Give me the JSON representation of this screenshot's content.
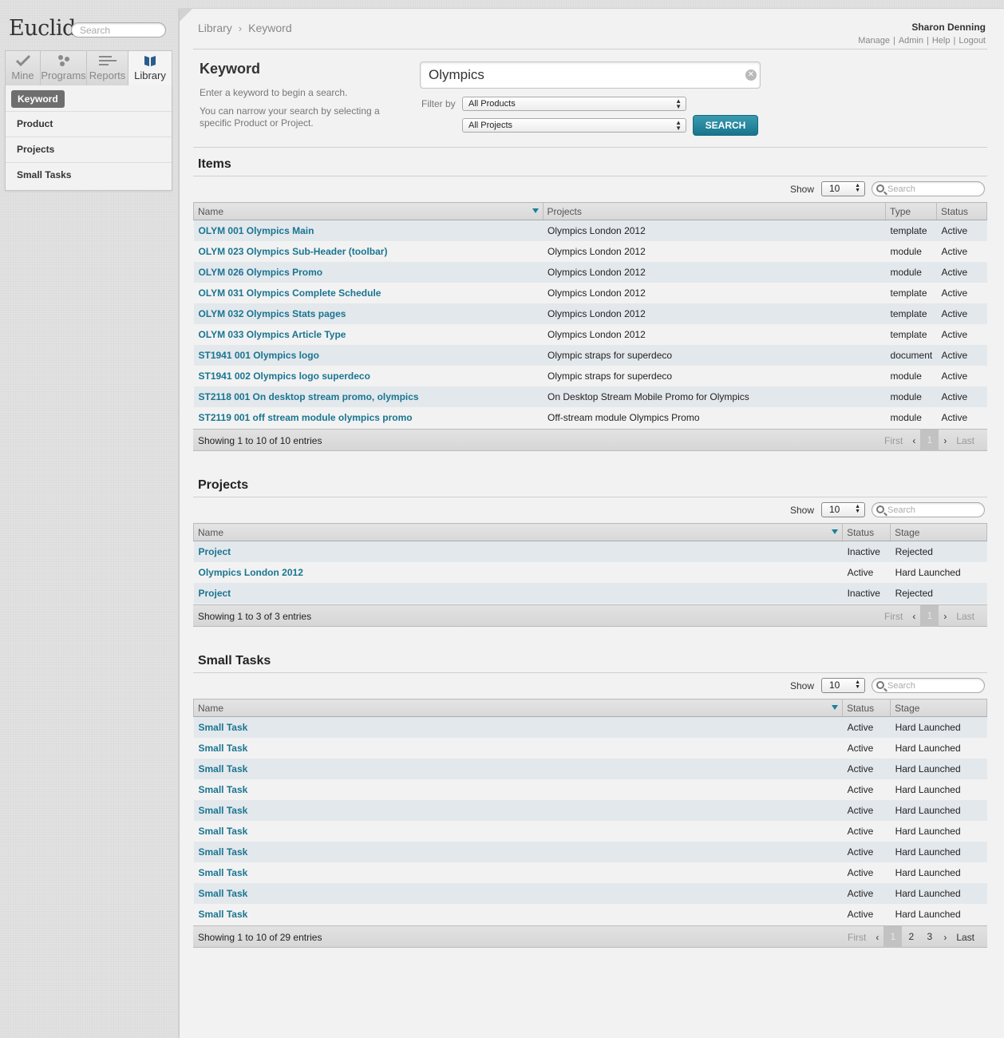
{
  "app": {
    "logo": "Euclid",
    "search_placeholder": "Search"
  },
  "sidebar": {
    "tabs": [
      {
        "label": "Mine",
        "icon": "check-icon"
      },
      {
        "label": "Programs",
        "icon": "dots-icon"
      },
      {
        "label": "Reports",
        "icon": "bars-icon"
      },
      {
        "label": "Library",
        "icon": "book-icon"
      }
    ],
    "active_item": "Keyword",
    "items": [
      "Product",
      "Projects",
      "Small Tasks"
    ]
  },
  "header": {
    "breadcrumb": [
      "Library",
      "Keyword"
    ],
    "user_name": "Sharon Denning",
    "user_menu": [
      "Manage",
      "Admin",
      "Help",
      "Logout"
    ]
  },
  "keyword": {
    "title": "Keyword",
    "help1": "Enter a keyword to begin a search.",
    "help2": "You can narrow your search by selecting a specific Product or Project.",
    "query": "Olympics",
    "filter_label": "Filter by",
    "product_filter": "All Products",
    "project_filter": "All Projects",
    "search_label": "SEARCH"
  },
  "items": {
    "title": "Items",
    "show_label": "Show",
    "show_value": "10",
    "search_placeholder": "Search",
    "columns": [
      "Name",
      "Projects",
      "Type",
      "Status"
    ],
    "rows": [
      [
        "OLYM 001 Olympics Main",
        "Olympics London 2012",
        "template",
        "Active"
      ],
      [
        "OLYM 023 Olympics Sub-Header (toolbar)",
        "Olympics London 2012",
        "module",
        "Active"
      ],
      [
        "OLYM 026 Olympics Promo",
        "Olympics London 2012",
        "module",
        "Active"
      ],
      [
        "OLYM 031 Olympics Complete Schedule",
        "Olympics London 2012",
        "template",
        "Active"
      ],
      [
        "OLYM 032 Olympics Stats pages",
        "Olympics London 2012",
        "template",
        "Active"
      ],
      [
        "OLYM 033 Olympics Article Type",
        "Olympics London 2012",
        "template",
        "Active"
      ],
      [
        "ST1941 001 Olympics logo",
        "Olympic straps for superdeco",
        "document",
        "Active"
      ],
      [
        "ST1941 002 Olympics logo superdeco",
        "Olympic straps for superdeco",
        "module",
        "Active"
      ],
      [
        "ST2118 001 On desktop stream promo, olympics",
        "On Desktop Stream Mobile Promo for Olympics",
        "module",
        "Active"
      ],
      [
        "ST2119 001 off stream module olympics promo",
        "Off-stream module Olympics Promo",
        "module",
        "Active"
      ]
    ],
    "info": "Showing 1 to 10 of 10 entries",
    "pager": {
      "first": "First",
      "last": "Last",
      "pages": [
        "1"
      ],
      "current": "1"
    }
  },
  "projects": {
    "title": "Projects",
    "show_label": "Show",
    "show_value": "10",
    "search_placeholder": "Search",
    "columns": [
      "Name",
      "Status",
      "Stage"
    ],
    "rows": [
      [
        "Project",
        "Inactive",
        "Rejected"
      ],
      [
        "Olympics London 2012",
        "Active",
        "Hard Launched"
      ],
      [
        "Project",
        "Inactive",
        "Rejected"
      ]
    ],
    "info": "Showing 1 to 3 of 3 entries",
    "pager": {
      "first": "First",
      "last": "Last",
      "pages": [
        "1"
      ],
      "current": "1"
    }
  },
  "small_tasks": {
    "title": "Small Tasks",
    "show_label": "Show",
    "show_value": "10",
    "search_placeholder": "Search",
    "columns": [
      "Name",
      "Status",
      "Stage"
    ],
    "rows": [
      [
        "Small Task",
        "Active",
        "Hard Launched"
      ],
      [
        "Small Task",
        "Active",
        "Hard Launched"
      ],
      [
        "Small Task",
        "Active",
        "Hard Launched"
      ],
      [
        "Small Task",
        "Active",
        "Hard Launched"
      ],
      [
        "Small Task",
        "Active",
        "Hard Launched"
      ],
      [
        "Small Task",
        "Active",
        "Hard Launched"
      ],
      [
        "Small Task",
        "Active",
        "Hard Launched"
      ],
      [
        "Small Task",
        "Active",
        "Hard Launched"
      ],
      [
        "Small Task",
        "Active",
        "Hard Launched"
      ],
      [
        "Small Task",
        "Active",
        "Hard Launched"
      ]
    ],
    "info": "Showing 1 to 10 of 29 entries",
    "pager": {
      "first": "First",
      "last": "Last",
      "pages": [
        "1",
        "2",
        "3"
      ],
      "current": "1"
    }
  },
  "colors": {
    "accent": "#1a7591",
    "button": "#17758c",
    "row_alt": "#e3e8ec"
  }
}
